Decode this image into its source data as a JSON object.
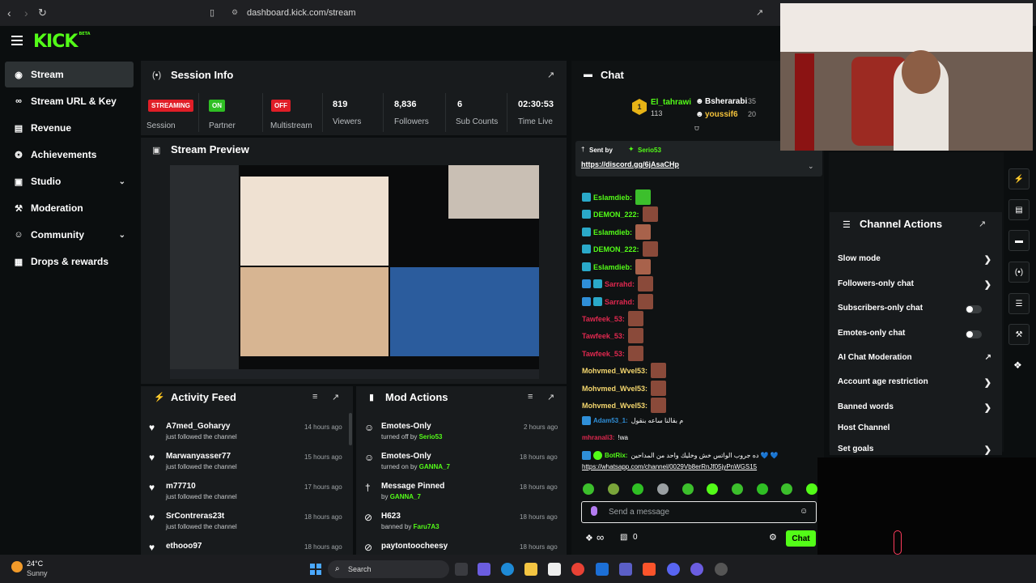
{
  "browser": {
    "url": "dashboard.kick.com/stream"
  },
  "app": {
    "logo": "KICK",
    "logo_badge": "BETA"
  },
  "sidebar": {
    "items": [
      {
        "label": "Stream",
        "icon": "broadcast-icon",
        "active": true
      },
      {
        "label": "Stream URL & Key",
        "icon": "link-icon"
      },
      {
        "label": "Revenue",
        "icon": "revenue-icon"
      },
      {
        "label": "Achievements",
        "icon": "trophy-icon"
      },
      {
        "label": "Studio",
        "icon": "studio-icon",
        "expandable": true
      },
      {
        "label": "Moderation",
        "icon": "wrench-icon"
      },
      {
        "label": "Community",
        "icon": "community-icon",
        "expandable": true
      },
      {
        "label": "Drops & rewards",
        "icon": "gift-icon"
      }
    ]
  },
  "session": {
    "title": "Session Info",
    "stats": [
      {
        "badge": "STREAMING",
        "label": "Session"
      },
      {
        "badge": "ON",
        "label": "Partner"
      },
      {
        "badge": "OFF",
        "label": "Multistream"
      },
      {
        "value": "819",
        "label": "Viewers"
      },
      {
        "value": "8,836",
        "label": "Followers"
      },
      {
        "value": "6",
        "label": "Sub Counts"
      },
      {
        "value": "02:30:53",
        "label": "Time Live"
      }
    ]
  },
  "preview": {
    "title": "Stream Preview"
  },
  "activity": {
    "title": "Activity Feed",
    "items": [
      {
        "name": "A7med_Goharyy",
        "sub": "just followed the channel",
        "time": "14 hours ago"
      },
      {
        "name": "Marwanyasser77",
        "sub": "just followed the channel",
        "time": "15 hours ago"
      },
      {
        "name": "m77710",
        "sub": "just followed the channel",
        "time": "17 hours ago"
      },
      {
        "name": "SrContreras23t",
        "sub": "just followed the channel",
        "time": "18 hours ago"
      },
      {
        "name": "ethooo97",
        "sub": "",
        "time": "18 hours ago"
      }
    ]
  },
  "mod": {
    "title": "Mod Actions",
    "items": [
      {
        "name": "Emotes-Only",
        "sub": "turned off by",
        "by": "Serio53",
        "time": "2 hours ago"
      },
      {
        "name": "Emotes-Only",
        "sub": "turned on by",
        "by": "GANNA_7",
        "time": "18 hours ago"
      },
      {
        "name": "Message Pinned",
        "sub": "by",
        "by": "GANNA_7",
        "time": "18 hours ago"
      },
      {
        "name": "H623",
        "sub": "banned by",
        "by": "Faru7A3",
        "time": "18 hours ago"
      },
      {
        "name": "paytontoocheesy",
        "sub": "",
        "by": "",
        "time": "18 hours ago"
      }
    ]
  },
  "chat": {
    "title": "Chat",
    "top_gifters": [
      {
        "name": "El_tahrawi",
        "count": "113"
      },
      {
        "name": "Bsherarabi",
        "count": "35"
      },
      {
        "name": "youssif6",
        "count": "20"
      }
    ],
    "pinned": {
      "sent_by_label": "Sent by",
      "sender": "Serio53",
      "link": "https://discord.gg/6jAsaCHp"
    },
    "messages": [
      {
        "user": "Eslamdieb:",
        "color": "#53fc18"
      },
      {
        "user": "DEMON_222:",
        "color": "#53fc18"
      },
      {
        "user": "Eslamdieb:",
        "color": "#53fc18"
      },
      {
        "user": "DEMON_222:",
        "color": "#53fc18"
      },
      {
        "user": "Eslamdieb:",
        "color": "#53fc18"
      },
      {
        "user": "Sarrahd:",
        "color": "#e0284f"
      },
      {
        "user": "Sarrahd:",
        "color": "#e0284f"
      },
      {
        "user": "Tawfeek_53:",
        "color": "#e0284f"
      },
      {
        "user": "Tawfeek_53:",
        "color": "#e0284f"
      },
      {
        "user": "Tawfeek_53:",
        "color": "#e0284f"
      },
      {
        "user": "Mohvmed_Wvel53:",
        "color": "#f5d76e"
      },
      {
        "user": "Mohvmed_Wvel53:",
        "color": "#f5d76e"
      },
      {
        "user": "Mohvmed_Wvel53:",
        "color": "#f5d76e"
      }
    ],
    "msg_adam_user": "Adam53_1:",
    "msg_adam_text": "م بقالنا ساعه بنقول",
    "msg_mhr_user": "mhranali3:",
    "msg_mhr_text": "!wa",
    "bot_user": "BotRix:",
    "bot_text": "ده جروب الواتس خش وخليك واحد من المداحين 💙 💙",
    "bot_link": "https://whatsapp.com/channel/0029Vb8erRnJf05jyPnWGS15",
    "input_placeholder": "Send a message",
    "send_label": "Chat",
    "viewers_count": "0",
    "infinity": "∞"
  },
  "channel_actions": {
    "title": "Channel Actions",
    "items": [
      {
        "label": "Slow mode",
        "control": "chevron"
      },
      {
        "label": "Followers-only chat",
        "control": "chevron"
      },
      {
        "label": "Subscribers-only chat",
        "control": "toggle"
      },
      {
        "label": "Emotes-only chat",
        "control": "toggle"
      },
      {
        "label": "AI Chat Moderation",
        "control": "external"
      },
      {
        "label": "Account age restriction",
        "control": "chevron"
      },
      {
        "label": "Banned words",
        "control": "chevron"
      },
      {
        "label": "Host Channel",
        "control": "none"
      },
      {
        "label": "Set goals",
        "control": "chevron"
      }
    ]
  },
  "taskbar": {
    "weather_temp": "24°C",
    "weather_desc": "Sunny",
    "search_label": "Search"
  },
  "colors": {
    "brand": "#53fc18",
    "streaming": "#e01e27",
    "on": "#2fbf24",
    "off": "#e01e27",
    "panel": "#181b1d"
  }
}
